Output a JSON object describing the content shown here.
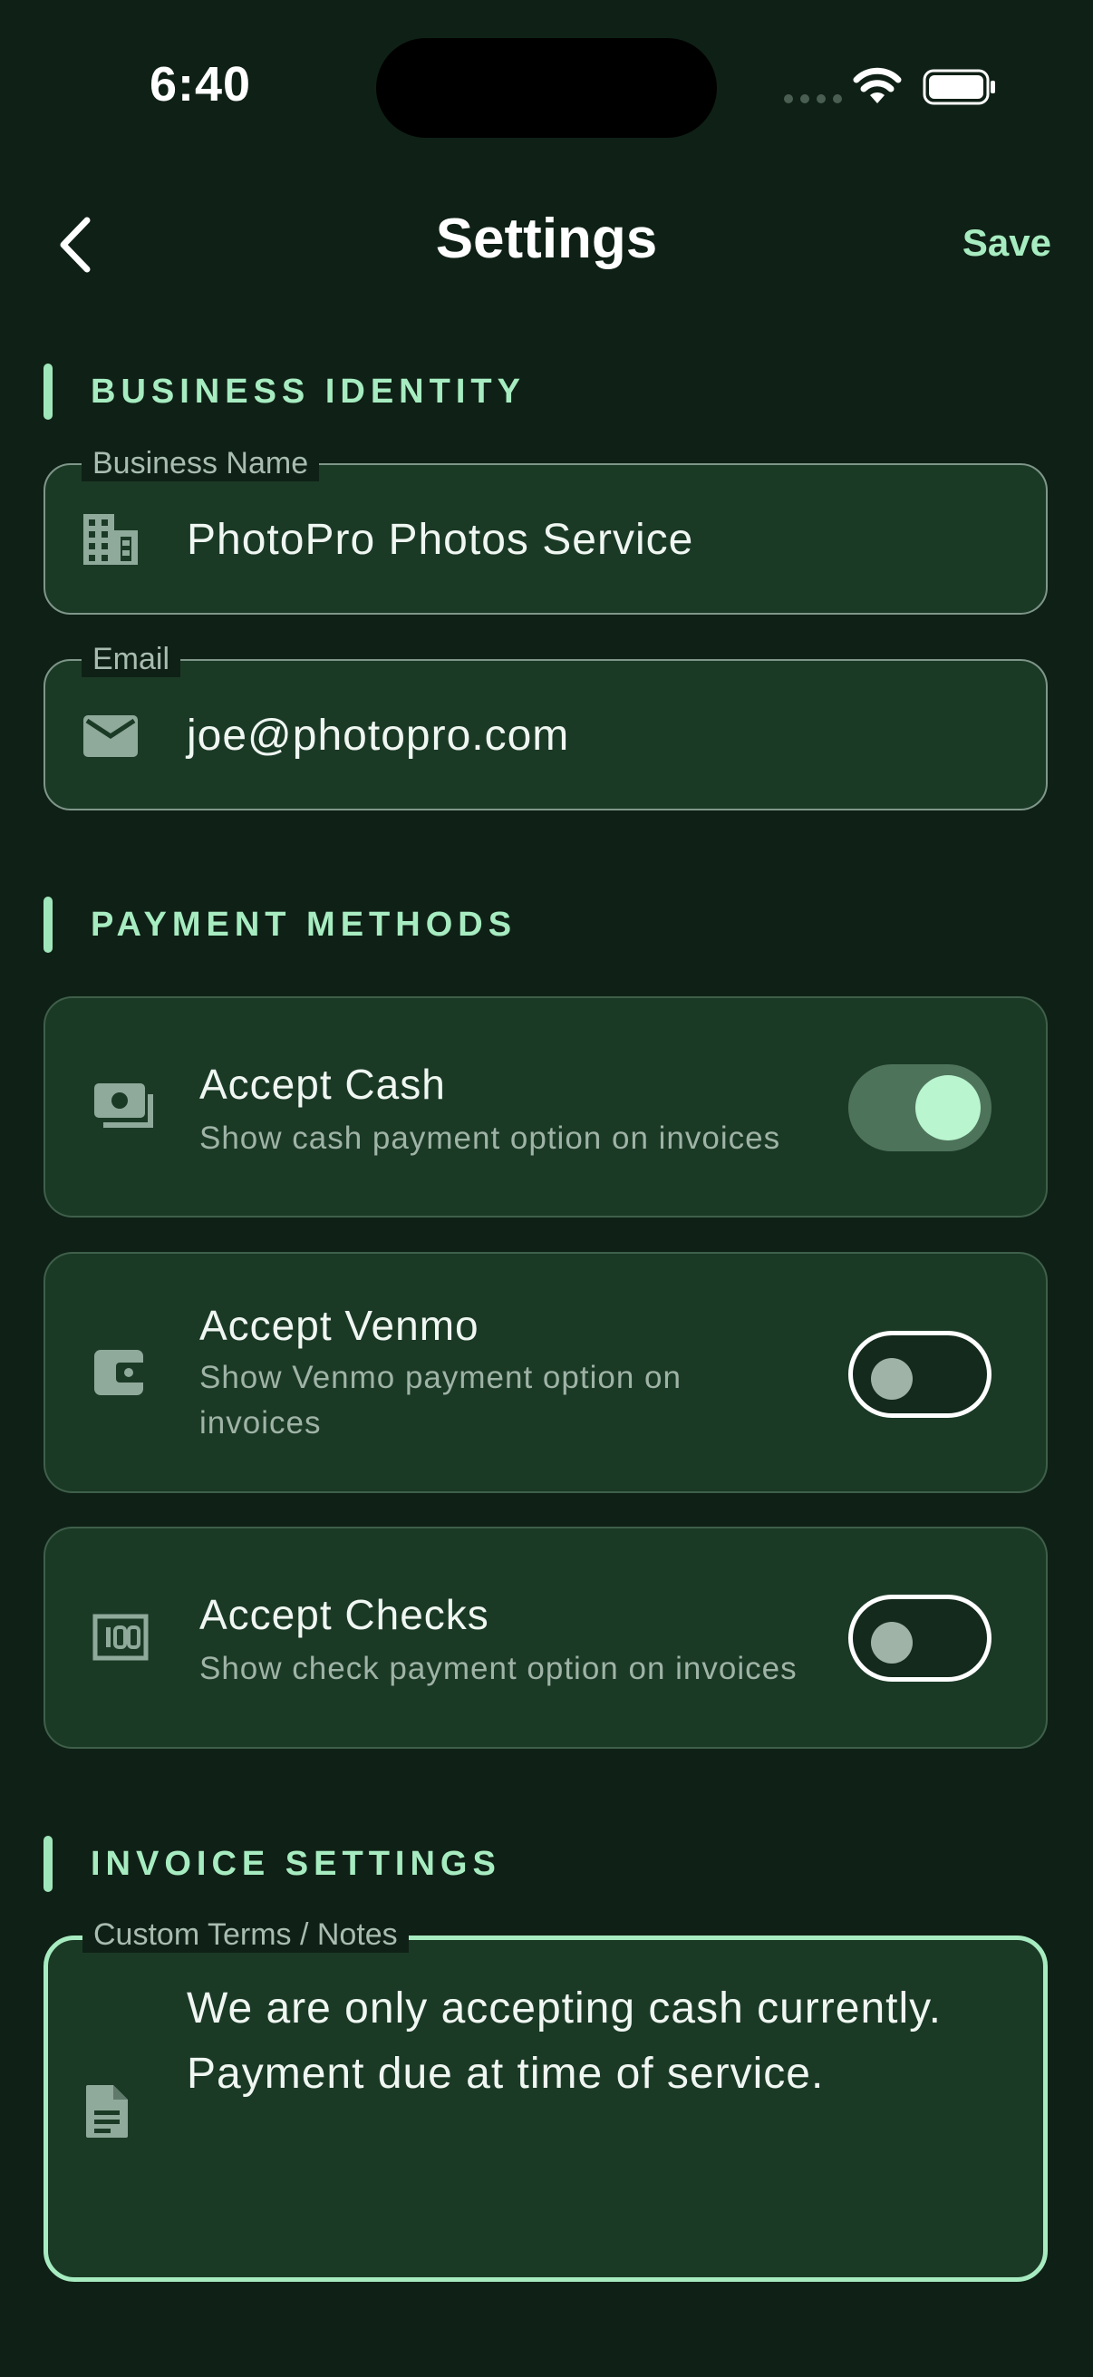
{
  "status_bar": {
    "time": "6:40"
  },
  "header": {
    "title": "Settings",
    "save_label": "Save"
  },
  "sections": {
    "business_identity": "BUSINESS IDENTITY",
    "payment_methods": "PAYMENT METHODS",
    "invoice_settings": "INVOICE SETTINGS"
  },
  "business": {
    "name_label": "Business Name",
    "name_value": "PhotoPro Photos Service",
    "email_label": "Email",
    "email_value": "joe@photopro.com"
  },
  "payments": [
    {
      "title": "Accept Cash",
      "subtitle": "Show cash payment option on invoices",
      "enabled": true,
      "icon": "cash-icon"
    },
    {
      "title": "Accept Venmo",
      "subtitle": "Show Venmo payment option on invoices",
      "enabled": false,
      "icon": "wallet-icon"
    },
    {
      "title": "Accept Checks",
      "subtitle": "Show check payment option on invoices",
      "enabled": false,
      "icon": "check-icon"
    }
  ],
  "invoice": {
    "notes_label": "Custom Terms / Notes",
    "notes_value": "We are only accepting cash currently. Payment due at time of service."
  },
  "colors": {
    "background": "#0f2116",
    "surface": "#1b3a26",
    "accent": "#a7ecc1"
  }
}
